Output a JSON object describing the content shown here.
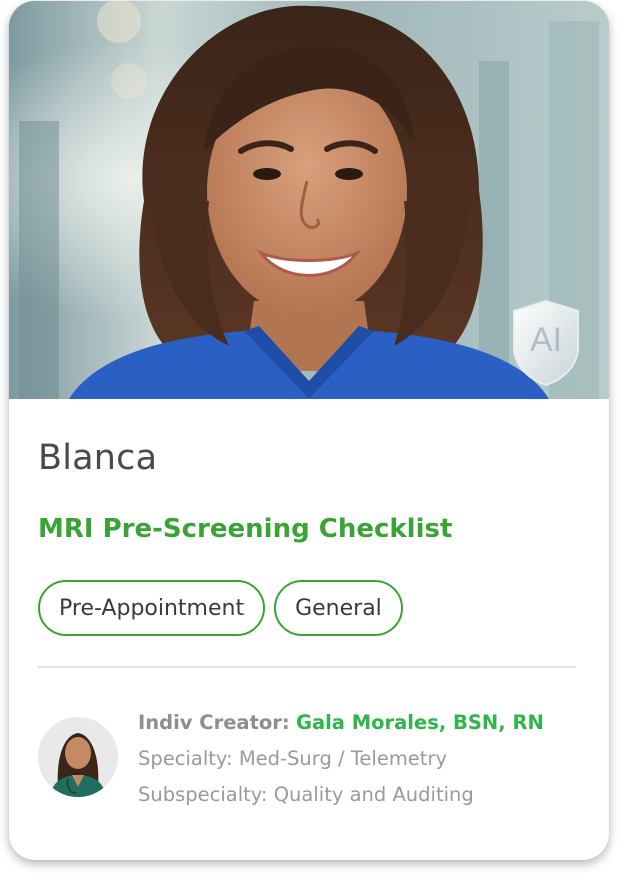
{
  "card": {
    "name": "Blanca",
    "title": "MRI Pre-Screening Checklist",
    "ai_badge_text": "AI",
    "tags": [
      "Pre-Appointment",
      "General"
    ],
    "creator": {
      "label": "Indiv Creator:",
      "name": "Gala Morales, BSN, RN",
      "specialty_label": "Specialty:",
      "specialty": "Med-Surg / Telemetry",
      "subspecialty_label": "Subspecialty:",
      "subspecialty": "Quality and Auditing"
    }
  },
  "colors": {
    "accent_green": "#3aa335",
    "creator_name_green": "#2fb64a",
    "scrub_blue": "#2a5fc4"
  },
  "icons": {
    "ai_badge": "shield-ai-icon"
  }
}
